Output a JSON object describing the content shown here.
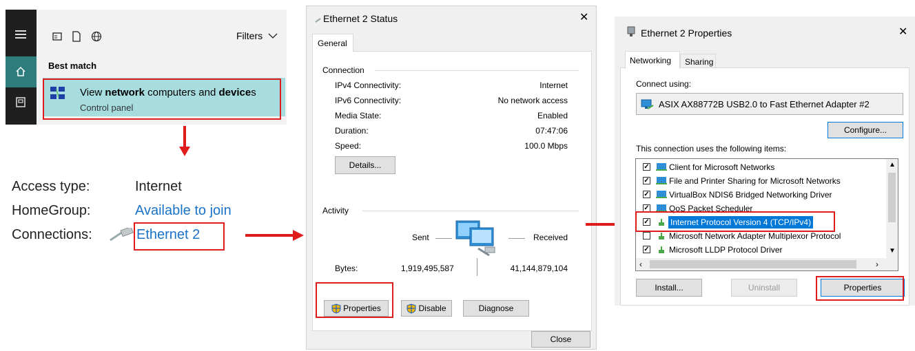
{
  "search_panel": {
    "filters_label": "Filters",
    "best_match_label": "Best match",
    "result_title_parts": [
      "View ",
      "network",
      " computers and ",
      "device",
      "s"
    ],
    "result_subtitle": "Control panel"
  },
  "network_info": {
    "access_type_label": "Access type:",
    "access_type_value": "Internet",
    "homegroup_label": "HomeGroup:",
    "homegroup_value": "Available to join",
    "connections_label": "Connections:",
    "connections_value": "Ethernet 2"
  },
  "status_dialog": {
    "title": "Ethernet 2 Status",
    "close_glyph": "✕",
    "tab_general": "General",
    "connection_group": "Connection",
    "rows": [
      {
        "label": "IPv4 Connectivity:",
        "value": "Internet"
      },
      {
        "label": "IPv6 Connectivity:",
        "value": "No network access"
      },
      {
        "label": "Media State:",
        "value": "Enabled"
      },
      {
        "label": "Duration:",
        "value": "07:47:06"
      },
      {
        "label": "Speed:",
        "value": "100.0 Mbps"
      }
    ],
    "details_button": "Details...",
    "activity_group": "Activity",
    "sent_label": "Sent",
    "received_label": "Received",
    "bytes_label": "Bytes:",
    "bytes_sent": "1,919,495,587",
    "bytes_received": "41,144,879,104",
    "properties_button": "Properties",
    "disable_button": "Disable",
    "diagnose_button": "Diagnose",
    "close_button": "Close"
  },
  "properties_dialog": {
    "title": "Ethernet 2 Properties",
    "close_glyph": "✕",
    "tab_networking": "Networking",
    "tab_sharing": "Sharing",
    "connect_using_label": "Connect using:",
    "adapter_name": "ASIX AX88772B USB2.0 to Fast Ethernet Adapter #2",
    "configure_button": "Configure...",
    "items_label": "This connection uses the following items:",
    "items": [
      {
        "label": "Client for Microsoft Networks",
        "checked": true
      },
      {
        "label": "File and Printer Sharing for Microsoft Networks",
        "checked": true
      },
      {
        "label": "VirtualBox NDIS6 Bridged Networking Driver",
        "checked": true
      },
      {
        "label": "QoS Packet Scheduler",
        "checked": true
      },
      {
        "label": "Internet Protocol Version 4 (TCP/IPv4)",
        "checked": true,
        "selected": true
      },
      {
        "label": "Microsoft Network Adapter Multiplexor Protocol",
        "checked": false
      },
      {
        "label": "Microsoft LLDP Protocol Driver",
        "checked": true
      }
    ],
    "install_button": "Install...",
    "uninstall_button": "Uninstall",
    "properties_button": "Properties"
  },
  "colors": {
    "highlight_red": "#e01b1b",
    "selection_blue": "#0078d7",
    "link_blue": "#1a73c8"
  }
}
